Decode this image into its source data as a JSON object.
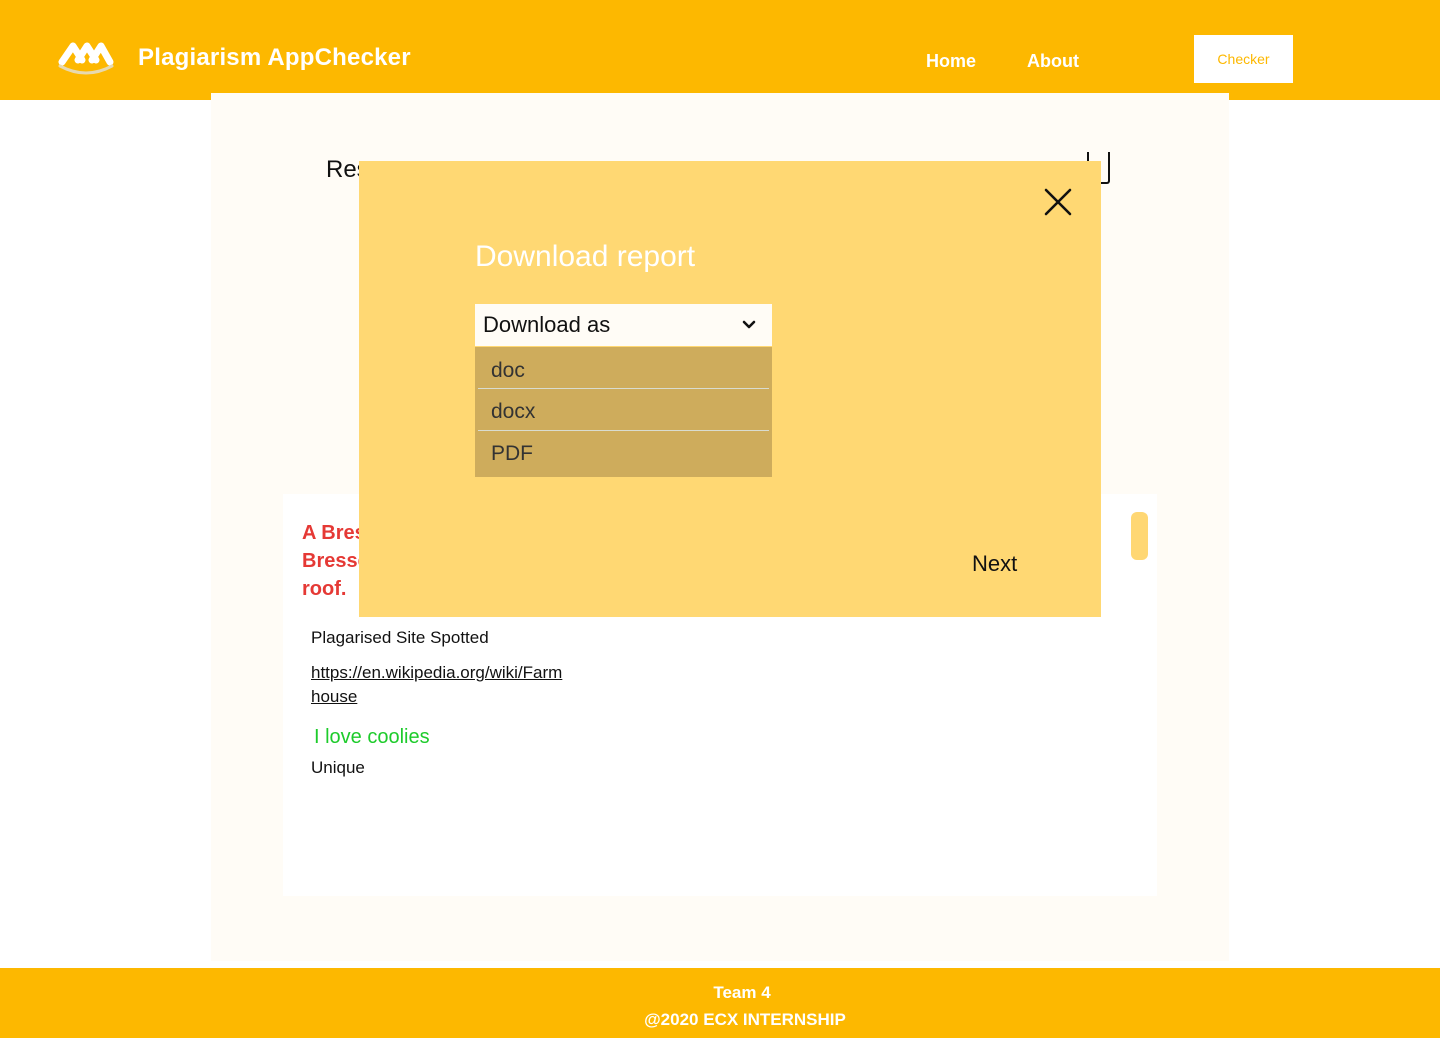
{
  "header": {
    "app_title": "Plagiarism AppChecker",
    "logo_icon": "app-logo-icon",
    "nav": {
      "home": "Home",
      "about": "About"
    },
    "checker_button": "Checker"
  },
  "main": {
    "results_heading": "Res",
    "plagiarised_text": "A Bres\nBresse\nroof.",
    "plagiarised_site_label": "Plagarised Site Spotted",
    "plagiarised_site_url": "https://en.wikipedia.org/wiki/Farmhouse",
    "unique_text": "I love coolies",
    "unique_label": "Unique"
  },
  "modal": {
    "title": "Download report",
    "close_icon": "close-icon",
    "select_label": "Download as",
    "select_icon": "chevron-down-icon",
    "options": [
      "doc",
      "docx",
      "PDF"
    ],
    "next_label": "Next"
  },
  "footer": {
    "team": "Team 4",
    "copyright": "@2020 ECX INTERNSHIP"
  },
  "colors": {
    "brand": "#FDB800",
    "modal_bg": "#FFD873",
    "dropdown_bg": "#CEAC5C",
    "plagiarised": "#E53935",
    "unique": "#1DCB2B"
  }
}
